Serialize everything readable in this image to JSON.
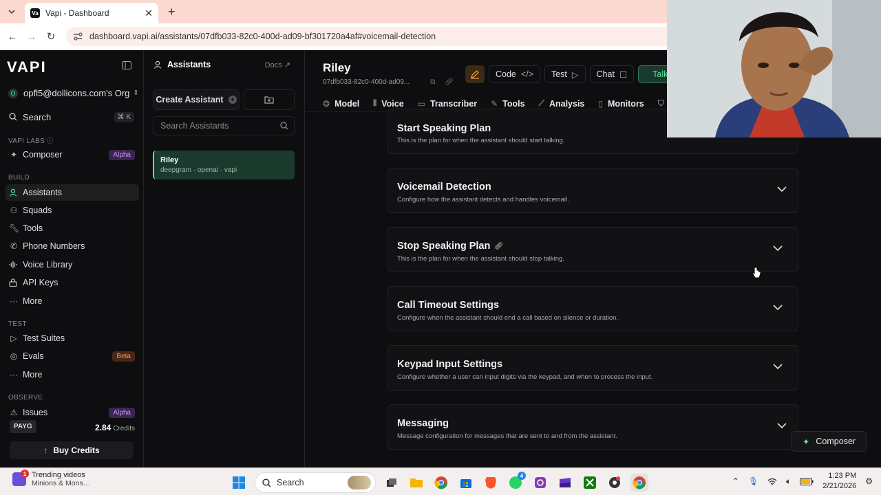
{
  "browser": {
    "tab_title": "Vapi - Dashboard",
    "url": "dashboard.vapi.ai/assistants/07dfb033-82c0-400d-ad09-bf301720a4af#voicemail-detection"
  },
  "sidebar": {
    "logo": "VAPI",
    "org": "opfl5@dollicons.com's Org",
    "org_initial": "O",
    "search_label": "Search",
    "search_shortcut": "⌘ K",
    "sections": {
      "labs": "VAPI LABS",
      "build": "BUILD",
      "test": "TEST",
      "observe": "OBSERVE"
    },
    "labs_items": [
      {
        "label": "Composer",
        "badge": "Alpha"
      }
    ],
    "build_items": [
      {
        "label": "Assistants",
        "active": true
      },
      {
        "label": "Squads"
      },
      {
        "label": "Tools"
      },
      {
        "label": "Phone Numbers"
      },
      {
        "label": "Voice Library"
      },
      {
        "label": "API Keys"
      },
      {
        "label": "More"
      }
    ],
    "test_items": [
      {
        "label": "Test Suites"
      },
      {
        "label": "Evals",
        "badge": "Beta"
      },
      {
        "label": "More"
      }
    ],
    "observe_items": [
      {
        "label": "Issues",
        "badge": "Alpha"
      }
    ],
    "plan": "PAYG",
    "credits_value": "2.84",
    "credits_label": "Credits",
    "buy_label": "Buy Credits"
  },
  "assistants_panel": {
    "title": "Assistants",
    "docs": "Docs",
    "create_label": "Create Assistant",
    "search_placeholder": "Search Assistants",
    "items": [
      {
        "name": "Riley",
        "sub": "deepgram · openai · vapi"
      }
    ]
  },
  "main": {
    "name": "Riley",
    "id": "07dfb033-82c0-400d-ad09...",
    "buttons": {
      "code": "Code",
      "test": "Test",
      "chat": "Chat",
      "talk": "Talk"
    },
    "tabs": [
      "Model",
      "Voice",
      "Transcriber",
      "Tools",
      "Analysis",
      "Monitors",
      "Co"
    ],
    "cards": [
      {
        "title": "Start Speaking Plan",
        "desc": "This is the plan for when the assistant should start talking."
      },
      {
        "title": "Voicemail Detection",
        "desc": "Configure how the assistant detects and handles voicemail."
      },
      {
        "title": "Stop Speaking Plan",
        "desc": "This is the plan for when the assistant should stop talking."
      },
      {
        "title": "Call Timeout Settings",
        "desc": "Configure when the assistant should end a call based on silence or duration."
      },
      {
        "title": "Keypad Input Settings",
        "desc": "Configure whether a user can input digits via the keypad, and when to process the input."
      },
      {
        "title": "Messaging",
        "desc": "Message configuration for messages that are sent to and from the assistant."
      }
    ],
    "composer_label": "Composer"
  },
  "taskbar": {
    "news_title": "Trending videos",
    "news_sub": "Minions & Mons...",
    "news_badge": "1",
    "search_label": "Search",
    "whatsapp_badge": "4",
    "time": "1:23 PM",
    "date": "2/21/2026"
  },
  "colors": {
    "accent": "#5ee0a0",
    "alpha_badge": "#c79af5",
    "beta_badge": "#f29a62",
    "tab_bar": "#fbd9d0"
  }
}
